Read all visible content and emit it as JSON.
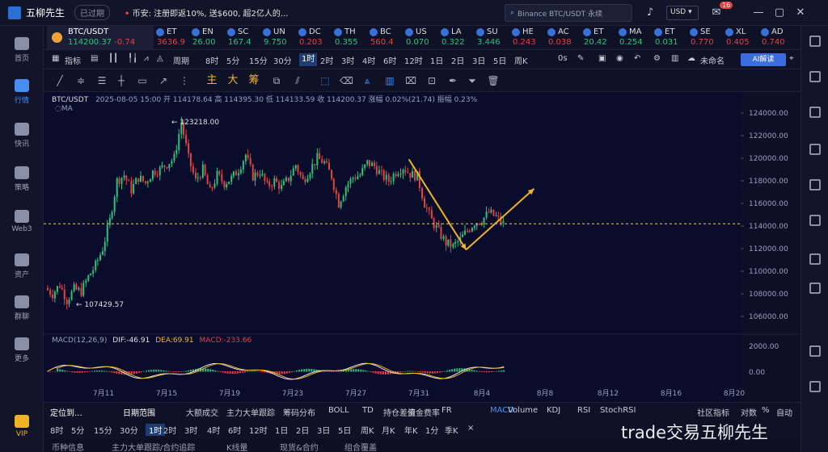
{
  "app": {
    "name": "五柳先生",
    "status": "已过期"
  },
  "news": {
    "marker": "•",
    "text": "币安: 注册即返10%, 送$600, 超2亿人的..."
  },
  "search": {
    "text": "Binance BTC/USDT 永续"
  },
  "header": {
    "currency": "USD",
    "mail_badge": "16"
  },
  "sidebar": {
    "items": [
      {
        "label": "首页"
      },
      {
        "label": "行情"
      },
      {
        "label": "快讯"
      },
      {
        "label": "策略"
      },
      {
        "label": "Web3"
      },
      {
        "label": "资产"
      },
      {
        "label": "群聊"
      },
      {
        "label": "更多"
      },
      {
        "label": "VIP"
      }
    ]
  },
  "rightbar": {
    "auto_label": "自动"
  },
  "ticker": {
    "main": {
      "name": "BTC/USDT",
      "price": "114200.37",
      "change": "-0.74"
    },
    "items": [
      {
        "name": "ET",
        "price": "3636.9",
        "dir": "dn"
      },
      {
        "name": "EN",
        "price": "26.00",
        "dir": "up"
      },
      {
        "name": "SC",
        "price": "167.4",
        "dir": "up"
      },
      {
        "name": "UN",
        "price": "9.750",
        "dir": "up"
      },
      {
        "name": "DC",
        "price": "0.203",
        "dir": "dn"
      },
      {
        "name": "TH",
        "price": "0.355",
        "dir": "up"
      },
      {
        "name": "BC",
        "price": "560.4",
        "dir": "dn"
      },
      {
        "name": "US",
        "price": "0.070",
        "dir": "up"
      },
      {
        "name": "LA",
        "price": "0.322",
        "dir": "up"
      },
      {
        "name": "SU",
        "price": "3.446",
        "dir": "up"
      },
      {
        "name": "HE",
        "price": "0.243",
        "dir": "dn"
      },
      {
        "name": "AC",
        "price": "0.038",
        "dir": "dn"
      },
      {
        "name": "ET",
        "price": "20.42",
        "dir": "up"
      },
      {
        "name": "MA",
        "price": "0.254",
        "dir": "up"
      },
      {
        "name": "ET",
        "price": "0.031",
        "dir": "up"
      },
      {
        "name": "SE",
        "price": "0.770",
        "dir": "dn"
      },
      {
        "name": "XL",
        "price": "0.405",
        "dir": "dn"
      },
      {
        "name": "AD",
        "price": "0.740",
        "dir": "dn"
      }
    ]
  },
  "toolbar": {
    "indicators": "指标",
    "period": "周期",
    "timeframes": [
      "8时",
      "5分",
      "15分",
      "30分",
      "1时",
      "2时",
      "3时",
      "4时",
      "6时",
      "12时",
      "1日",
      "2日",
      "3日",
      "5日",
      "周K"
    ],
    "active_tf": "1时",
    "seconds": "0s",
    "unnamed": "未命名",
    "ai": "AI解读"
  },
  "drawtools": {
    "labels": [
      "主",
      "大",
      "筹"
    ]
  },
  "chart_header": {
    "symbol": "BTC/USDT",
    "info": "2025-08-05 15:00  开 114178.64  高 114395.30  低 114133.59  收 114200.37  涨幅 0.02%(21.74)  振幅 0.23%",
    "ma": "MA",
    "macd_name": "MACD(12,26,9)",
    "dif": "DIF:-46.91",
    "dea": "DEA:69.91",
    "macd": "MACD:-233.66"
  },
  "chart_data": {
    "type": "candlestick",
    "symbol": "BTC/USDT",
    "interval": "1h",
    "price_axis": [
      124000,
      122000,
      120000,
      118000,
      116000,
      114000,
      112000,
      110000,
      108000,
      106000
    ],
    "price_axis_labels": [
      "124000.00",
      "122000.00",
      "120000.00",
      "118000.00",
      "116000.00",
      "114000.00",
      "112000.00",
      "110000.00",
      "108000.00",
      "106000.00"
    ],
    "date_axis": [
      "7月11",
      "7月15",
      "7月19",
      "7月23",
      "7月27",
      "7月31",
      "8月4",
      "8月8",
      "8月12",
      "8月16",
      "8月20"
    ],
    "high_label": "123218.00",
    "low_label": "107429.57",
    "current_price": 114200.37,
    "macd_axis": [
      "2000.00",
      "0.00"
    ],
    "macd": {
      "dif": -46.91,
      "dea": 69.91,
      "macd": -233.66
    },
    "path": [
      [
        0,
        108500
      ],
      [
        2,
        108000
      ],
      [
        4,
        108800
      ],
      [
        6,
        107430
      ],
      [
        8,
        108400
      ],
      [
        10,
        108200
      ],
      [
        12,
        109500
      ],
      [
        14,
        110500
      ],
      [
        16,
        112000
      ],
      [
        18,
        114500
      ],
      [
        20,
        118000
      ],
      [
        22,
        118500
      ],
      [
        24,
        117200
      ],
      [
        26,
        118300
      ],
      [
        28,
        117800
      ],
      [
        30,
        118800
      ],
      [
        32,
        119000
      ],
      [
        34,
        119500
      ],
      [
        36,
        120000
      ],
      [
        38,
        123218
      ],
      [
        40,
        120000
      ],
      [
        42,
        118000
      ],
      [
        44,
        119000
      ],
      [
        46,
        117000
      ],
      [
        48,
        118500
      ],
      [
        50,
        117800
      ],
      [
        52,
        118200
      ],
      [
        54,
        119000
      ],
      [
        56,
        120300
      ],
      [
        58,
        118400
      ],
      [
        60,
        118800
      ],
      [
        62,
        117500
      ],
      [
        64,
        118000
      ],
      [
        66,
        117400
      ],
      [
        68,
        118200
      ],
      [
        70,
        119400
      ],
      [
        72,
        118000
      ],
      [
        74,
        119000
      ],
      [
        76,
        120000
      ],
      [
        78,
        119600
      ],
      [
        80,
        118400
      ],
      [
        82,
        116000
      ],
      [
        84,
        117500
      ],
      [
        86,
        118300
      ],
      [
        88,
        118500
      ],
      [
        90,
        119600
      ],
      [
        92,
        119300
      ],
      [
        94,
        118500
      ],
      [
        96,
        118000
      ],
      [
        98,
        118800
      ],
      [
        100,
        119200
      ],
      [
        102,
        118600
      ],
      [
        104,
        118400
      ],
      [
        106,
        116000
      ],
      [
        108,
        114500
      ],
      [
        110,
        113500
      ],
      [
        112,
        112500
      ],
      [
        114,
        112200
      ],
      [
        116,
        112800
      ],
      [
        118,
        113600
      ],
      [
        120,
        114300
      ],
      [
        122,
        114500
      ],
      [
        124,
        115200
      ],
      [
        126,
        114800
      ],
      [
        128,
        114200
      ]
    ],
    "annotation_lines": [
      {
        "from": [
          101,
          119900
        ],
        "to": [
          117,
          111900
        ]
      },
      {
        "from": [
          117,
          111900
        ],
        "to": [
          136,
          117300
        ]
      }
    ]
  },
  "bottom": {
    "position_label": "定位到...",
    "range_label": "日期范围",
    "indicators": [
      "大额成交",
      "主力大单跟踪",
      "筹码分布",
      "BOLL",
      "TD",
      "持仓差值",
      "资金费率",
      "FR",
      "MACD",
      "Volume",
      "KDJ",
      "RSI",
      "StochRSI"
    ],
    "active_indicator": "MACD",
    "community": "社区指标",
    "log": "对数",
    "percent": "%",
    "auto": "自动",
    "periods": [
      "8时",
      "5分",
      "15分",
      "30分",
      "1时",
      "2时",
      "3时",
      "4时",
      "6时",
      "12时",
      "1日",
      "2日",
      "3日",
      "5日",
      "周K",
      "月K",
      "年K",
      "1分",
      "季K"
    ],
    "active_period": "1时",
    "close": "×",
    "tabs": [
      "币种信息",
      "主力大单跟踪/合约追踪",
      "K线量",
      "现货&合约",
      "组合覆盖"
    ]
  },
  "watermark": {
    "text": "trade交易五柳先生"
  }
}
